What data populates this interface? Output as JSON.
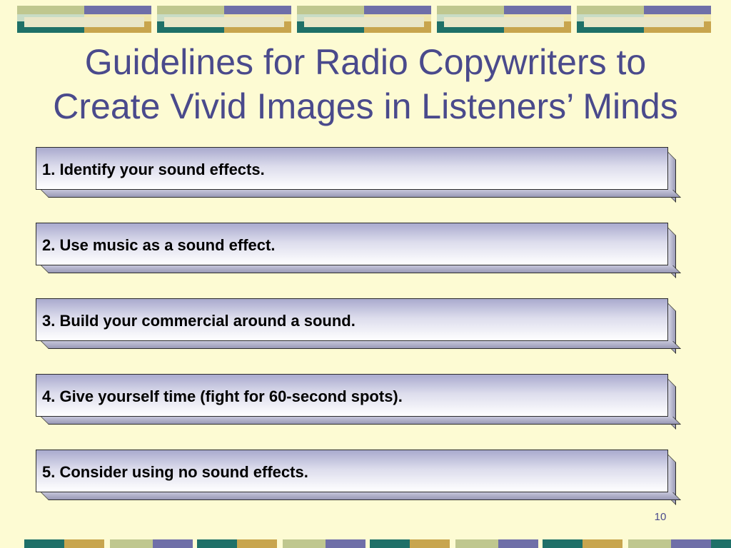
{
  "slide": {
    "title_line1": "Guidelines for Radio Copywriters to",
    "title_line2": "Create Vivid Images in Listeners’ Minds",
    "items": [
      {
        "label": "1.  Identify your sound effects."
      },
      {
        "label": "2.  Use music as a sound effect."
      },
      {
        "label": "3.  Build your commercial around a sound."
      },
      {
        "label": "4.  Give yourself time (fight for 60-second spots)."
      },
      {
        "label": "5.  Consider using no sound effects."
      }
    ],
    "page_number": "10"
  },
  "colors": {
    "background": "#fdfbd3",
    "title": "#4a4a8c",
    "band_teal": "#1f7068",
    "band_gold": "#c8a54e",
    "band_purple": "#6f6fa8",
    "band_sage": "#bfc78f"
  }
}
